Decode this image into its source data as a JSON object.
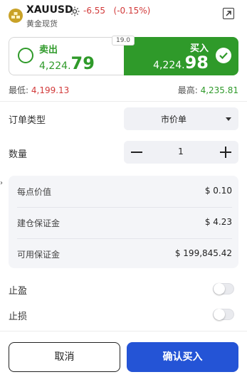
{
  "header": {
    "symbol": "XAUUSD",
    "change": "-6.55",
    "change_pct": "(-0.15%)",
    "subtitle": "黄金现货",
    "colors": {
      "negative": "#d23a3a",
      "positive": "#2f9a2a"
    }
  },
  "quote": {
    "spread": "19.0",
    "sell": {
      "label": "卖出",
      "price_prefix": "4,224.",
      "price_suffix": "79",
      "color": "#2f9a2a"
    },
    "buy": {
      "label": "买入",
      "price_prefix": "4,224.",
      "price_suffix": "98",
      "color": "#2f9a2a",
      "selected": true
    }
  },
  "range": {
    "low_label": "最低:",
    "low_value": "4,199.13",
    "high_label": "最高:",
    "high_value": "4,235.81"
  },
  "order": {
    "type_label": "订单类型",
    "type_value": "市价单",
    "qty_label": "数量",
    "qty_value": "1"
  },
  "info": {
    "rows": [
      {
        "label": "每点价值",
        "value": "$ 0.10"
      },
      {
        "label": "建仓保证金",
        "value": "$ 4.23"
      },
      {
        "label": "可用保证金",
        "value": "$ 199,845.42"
      }
    ]
  },
  "options": {
    "take_profit_label": "止盈",
    "stop_loss_label": "止损",
    "take_profit_on": false,
    "stop_loss_on": false
  },
  "actions": {
    "cancel_label": "取消",
    "confirm_label": "确认买入",
    "confirm_color": "#2454d6"
  },
  "icons": {
    "gold": "gold-bars-icon",
    "market_status": "sun-icon",
    "expand": "external-link-icon",
    "sell_radio": "radio-circle-icon",
    "buy_check": "check-circle-icon"
  }
}
